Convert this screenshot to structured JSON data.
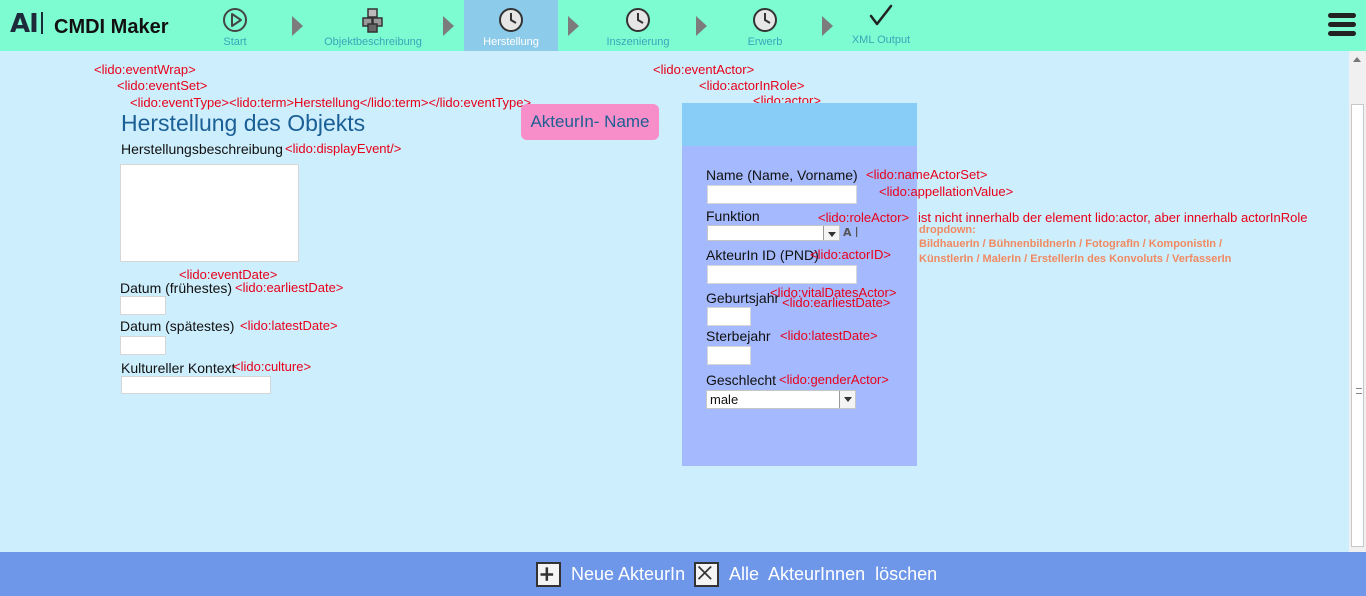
{
  "app": {
    "logo": "AI",
    "title": "CMDI Maker"
  },
  "steps": [
    {
      "label": "Start",
      "icon": "play-icon"
    },
    {
      "label": "Objektbeschreibung",
      "icon": "cubes-icon"
    },
    {
      "label": "Herstellung",
      "icon": "clock-icon",
      "active": true
    },
    {
      "label": "Inszenierung",
      "icon": "clock-icon"
    },
    {
      "label": "Erwerb",
      "icon": "clock-icon"
    },
    {
      "label": "XML Output",
      "icon": "checkmark-icon"
    }
  ],
  "annotations": {
    "event_wrap": "<lido:eventWrap>",
    "event_set": "<lido:eventSet>",
    "event_type": "<lido:eventType><lido:term>Herstellung</lido:term></lido:eventType>",
    "display_event": "<lido:displayEvent/>",
    "event_date": "<lido:eventDate>",
    "earliest_date": "<lido:earliestDate>",
    "latest_date": "<lido:latestDate>",
    "culture": "<lido:culture>",
    "event_actor": "<lido:eventActor>",
    "actor_in_role": "<lido:actorInRole>",
    "actor": "<lido:actor>",
    "name_actor_set": "<lido:nameActorSet>",
    "appellation_value": "<lido:appellationValue>",
    "role_actor": "<lido:roleActor>",
    "role_actor_note": "ist nicht innerhalb der element lido:actor, aber innerhalb actorInRole",
    "actor_id": "<lido:actorID>",
    "vital_dates_actor": "<lido:vitalDatesActor>",
    "actor_earliest_date": "<lido:earliestDate>",
    "actor_latest_date": "<lido:latestDate>",
    "gender_actor": "<lido:genderActor>",
    "dropdown_title": "dropdown:",
    "dropdown_line1": "BildhauerIn / BühnenbildnerIn / FotografIn / KomponistIn /",
    "dropdown_line2": "KünstlerIn / MalerIn / ErstellerIn des Konvoluts / VerfasserIn"
  },
  "form": {
    "heading": "Herstellung des Objekts",
    "description_label": "Herstellungsbeschreibung",
    "date_earliest_label": "Datum (frühestes)",
    "date_latest_label": "Datum (spätestes)",
    "culture_label": "Kultureller Kontext"
  },
  "actor": {
    "tab_label": "AkteurIn- Name",
    "name_label": "Name (Name, Vorname)",
    "function_label": "Funktion",
    "id_label": "AkteurIn ID (PND)",
    "birth_label": "Geburtsjahr",
    "death_label": "Sterbejahr",
    "gender_label": "Geschlecht",
    "gender_value": "male"
  },
  "bottom": {
    "new_actor": "Neue AkteurIn",
    "delete_all": "Alle  AkteurInnen  löschen"
  },
  "colors": {
    "topbar": "#7dfcd2",
    "active_step": "#8ccbea",
    "page_bg": "#cdeefc",
    "annotation_red": "#e8001a",
    "actor_panel": "#a5bafe",
    "actor_tab": "#f78ec9",
    "bottombar": "#6e96e9"
  }
}
